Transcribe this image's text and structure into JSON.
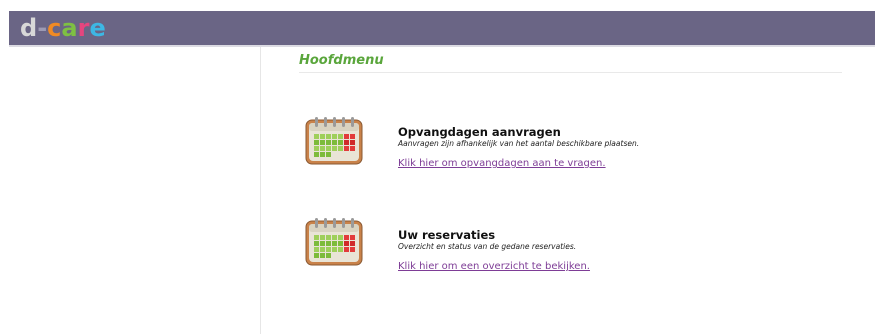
{
  "header": {
    "logo": {
      "letters": [
        "d",
        "-",
        "c",
        "a",
        "r",
        "e"
      ]
    },
    "colors": {
      "bar": "#6a6585",
      "logo_c": "#f08a24",
      "logo_a": "#7ec043",
      "logo_r": "#e5457e",
      "logo_e": "#3db7e4"
    }
  },
  "main": {
    "title": "Hoofdmenu",
    "title_color": "#5aa63c",
    "link_color": "#7e3d96",
    "items": [
      {
        "icon": "calendar-icon",
        "heading": "Opvangdagen aanvragen",
        "description": "Aanvragen zijn afhankelijk van het aantal beschikbare plaatsen.",
        "link": "Klik hier om opvangdagen aan te vragen."
      },
      {
        "icon": "calendar-icon",
        "heading": "Uw reservaties",
        "description": "Overzicht en status van de gedane reservaties.",
        "link": "Klik hier om een overzicht te bekijken."
      }
    ]
  }
}
